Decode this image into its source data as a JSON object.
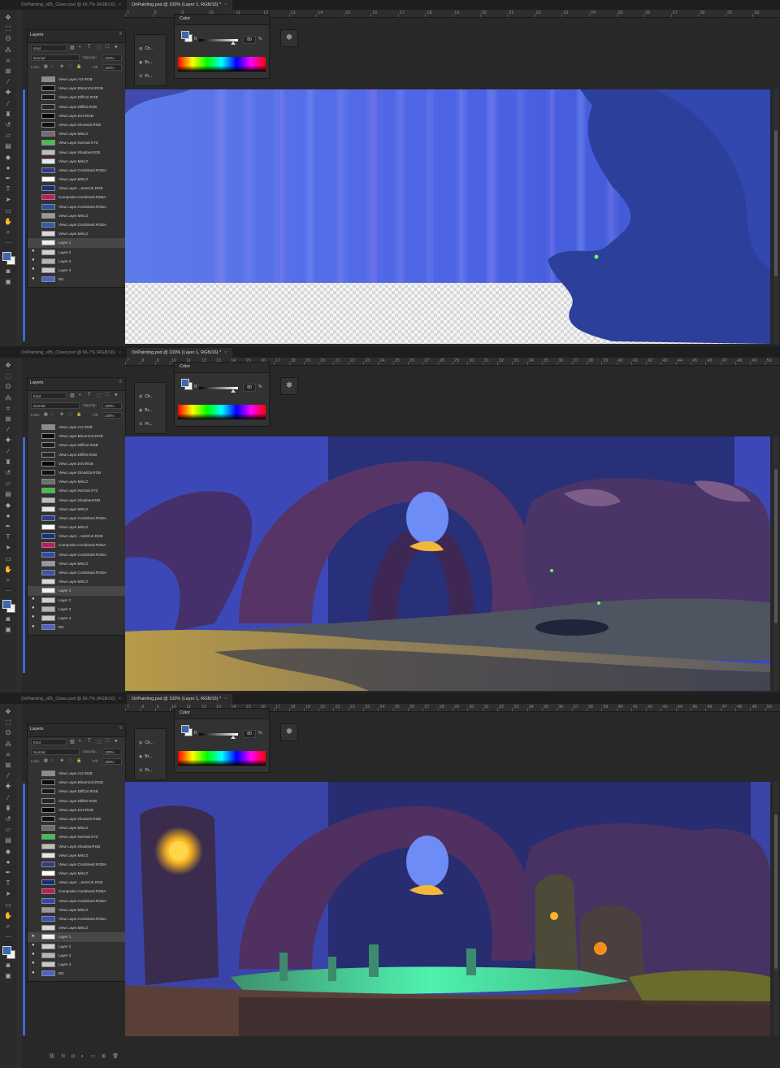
{
  "frames": [
    {
      "tabs": [
        "OriPainting_v85_Clean.psd @ 66.7% (RGB/16)",
        "OriPainting.psd @ 100% (Layer 1, RGB/16) *"
      ],
      "ruler_start": 7,
      "ruler_end": 30,
      "canvas_state": "blue-sky-partial",
      "layers_visible": [
        false,
        false,
        false,
        false,
        false,
        false,
        false,
        false,
        false,
        false,
        false,
        false,
        false,
        false,
        false,
        false,
        false,
        false,
        false,
        true,
        true,
        true,
        true
      ]
    },
    {
      "tabs": [
        "OriPainting_v85_Clean.psd @ 66.7% (RGB/16)",
        "OriPainting.psd @ 100% (Layer 1, RGB/16) *"
      ],
      "ruler_start": 7,
      "ruler_end": 50,
      "canvas_state": "tree-arch",
      "layers_visible": [
        false,
        false,
        false,
        false,
        false,
        false,
        false,
        false,
        false,
        false,
        false,
        false,
        false,
        false,
        false,
        false,
        false,
        false,
        false,
        true,
        true,
        true,
        true
      ]
    },
    {
      "tabs": [
        "OriPainting_v85_Clean.psd @ 66.7% (RGB/16)",
        "OriPainting.psd @ 100% (Layer 1, RGB/16) *"
      ],
      "ruler_start": 7,
      "ruler_end": 50,
      "canvas_state": "full-scene",
      "layers_visible": [
        false,
        false,
        false,
        false,
        false,
        false,
        false,
        false,
        false,
        false,
        false,
        false,
        false,
        false,
        false,
        false,
        false,
        false,
        true,
        true,
        true,
        true,
        true
      ]
    }
  ],
  "tab_close": "×",
  "layers_panel": {
    "title": "Layers",
    "menu": "≡",
    "filter_kind": "Kind",
    "blend_mode": "Normal",
    "opacity_label": "Opacity:",
    "opacity_value": "100%",
    "lock_label": "Lock:",
    "fill_label": "Fill:",
    "fill_value": "100%",
    "layers": [
      {
        "name": "View Layer.AO.RGB",
        "thumb": "#8c8c8c"
      },
      {
        "name": "View Layer.BloomCol.RGB",
        "thumb": "#0d0d0d"
      },
      {
        "name": "View Layer.DiffCol.RGB",
        "thumb": "#1b1b1b"
      },
      {
        "name": "View Layer.DiffDir.RGB",
        "thumb": "#262626"
      },
      {
        "name": "View Layer.Emi.RGB",
        "thumb": "#050505"
      },
      {
        "name": "View Layer.GlossDir.RGB",
        "thumb": "#111111"
      },
      {
        "name": "View Layer.Mist.Z",
        "thumb": "#6e6e6e"
      },
      {
        "name": "View Layer.Normal.XYZ",
        "thumb": "#3fc24a"
      },
      {
        "name": "View Layer.Shadow.RGB",
        "thumb": "#bdbdbd"
      },
      {
        "name": "View Layer.Mist.Z",
        "thumb": "#e6e6e6"
      },
      {
        "name": "View Layer.Combined.RGBA",
        "thumb": "#2c3f86"
      },
      {
        "name": "View Layer.Mist.Z",
        "thumb": "#ffffff"
      },
      {
        "name": "View Layer....eemCol.RGB",
        "thumb": "#1a2f7a"
      },
      {
        "name": "Composite.Combined.RGBA",
        "thumb": "#c8185a"
      },
      {
        "name": "View Layer.Combined.RGBA",
        "thumb": "#2b4cb0"
      },
      {
        "name": "View Layer.Mist.Z",
        "thumb": "#9a9a9a"
      },
      {
        "name": "View Layer.Combined.RGBA",
        "thumb": "#3556b8"
      },
      {
        "name": "View Layer.Mist.Z",
        "thumb": "#d9d9d9"
      },
      {
        "name": "Layer 1",
        "thumb": "#f0f0f0"
      },
      {
        "name": "Layer 2",
        "thumb": "#cfcfcf"
      },
      {
        "name": "Layer 3",
        "thumb": "#b5b5b5"
      },
      {
        "name": "Layer 4",
        "thumb": "#c9c9c9"
      },
      {
        "name": "BG",
        "thumb": "#4466cc"
      }
    ],
    "selected": "Layer 1"
  },
  "channels_panel": {
    "items": [
      "Ch...",
      "Br...",
      "Pr..."
    ]
  },
  "color_panel": {
    "title": "Color",
    "slider_label": "B",
    "slider_value": "80",
    "unit": "%"
  },
  "colors": {
    "foreground": "#3d67b0",
    "background": "#f2f2f2"
  },
  "icons": {
    "snowflake": "❄",
    "eye": "●"
  }
}
